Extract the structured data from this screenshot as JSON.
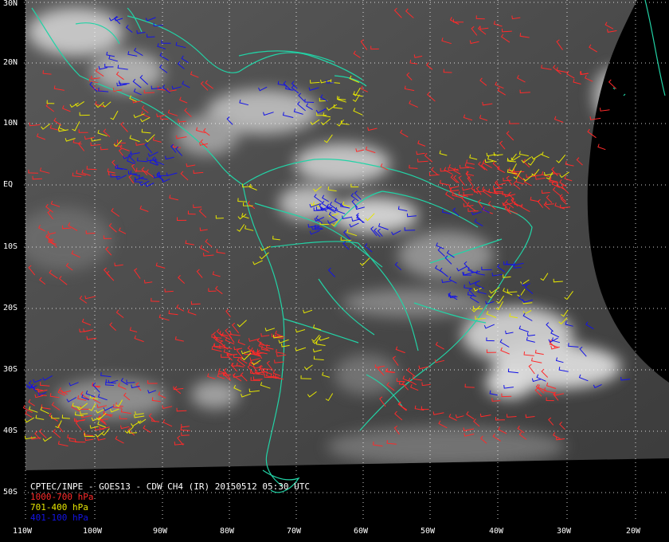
{
  "title": "CPTEC/INPE - GOES13 - CDW CH4 (IR) 20150512 05:30 UTC",
  "legend": [
    {
      "label": "1000-700 hPa",
      "color": "#ff2a2a"
    },
    {
      "label": "701-400 hPa",
      "color": "#e6e600"
    },
    {
      "label": "401-100 hPa",
      "color": "#1414e6"
    }
  ],
  "lat_labels": [
    "30N",
    "20N",
    "10N",
    "EQ",
    "10S",
    "20S",
    "30S",
    "40S",
    "50S"
  ],
  "lon_labels": [
    "110W",
    "100W",
    "90W",
    "80W",
    "70W",
    "60W",
    "50W",
    "40W",
    "30W",
    "20W"
  ],
  "coast_color": "#22d3a6"
}
